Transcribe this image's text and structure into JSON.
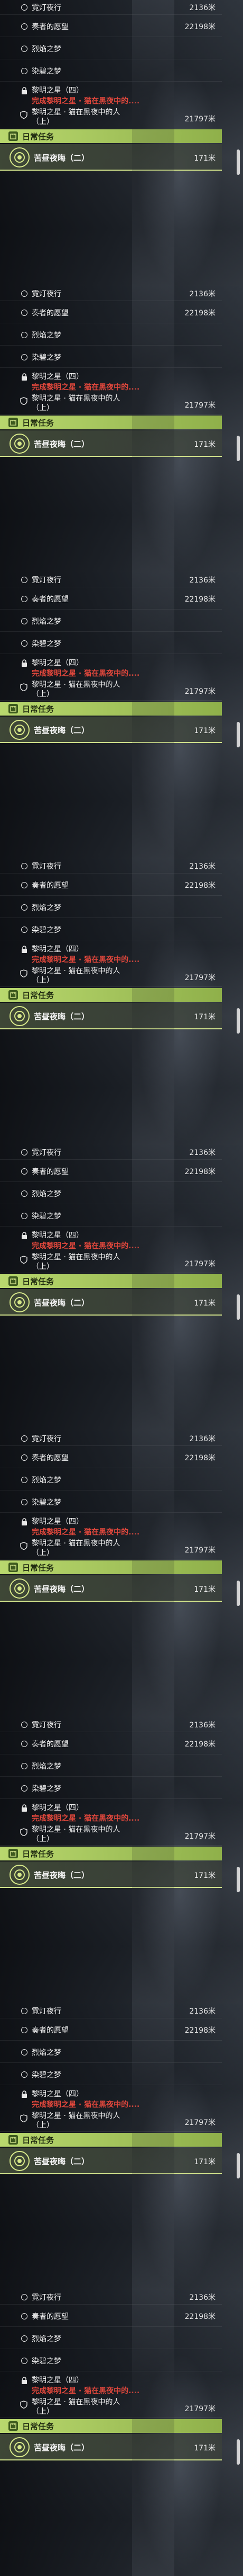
{
  "panels": [
    0,
    1,
    2,
    3,
    4,
    5,
    6,
    7,
    8
  ],
  "quests": {
    "row1": {
      "title": "霓灯夜行",
      "distance": "2136米"
    },
    "row2": {
      "title": "奏者的愿望",
      "distance": "22198米"
    },
    "row3": {
      "title": "烈焰之梦"
    },
    "row4": {
      "title": "染碧之梦"
    },
    "row5": {
      "title_a": "黎明之星（四）",
      "title_b": "完成黎明之星 · 猫在黑夜中的....",
      "title_c": "黎明之星 · 猫在黑夜中的人",
      "title_d": "（上）",
      "distance": "21797米"
    }
  },
  "daily": {
    "header": "日常任务",
    "task": "苦昼夜晦（二）",
    "distance": "171米"
  },
  "colors": {
    "accent_green": "#b9d86e",
    "warning_red": "#e0473c"
  }
}
